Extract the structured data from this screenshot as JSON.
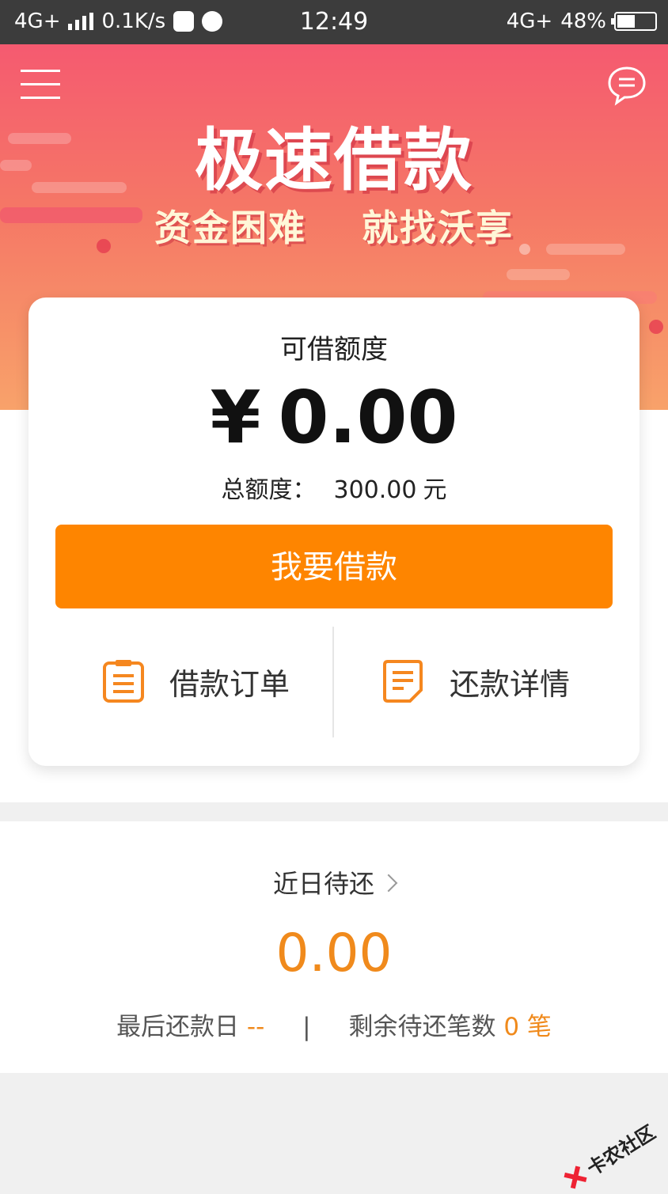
{
  "status_bar": {
    "network": "4G+",
    "speed": "0.1K/s",
    "time": "12:49",
    "network_right": "4G+",
    "battery": "48%",
    "battery_level": 0.48
  },
  "header": {
    "menu_icon": "hamburger-menu-icon",
    "chat_icon": "chat-bubble-icon"
  },
  "hero": {
    "title": "极速借款",
    "subtitle_left": "资金困难",
    "subtitle_right": "就找沃享"
  },
  "card": {
    "available_label": "可借额度",
    "currency": "¥",
    "available_amount": "0.00",
    "total_label": "总额度：",
    "total_amount": "300.00",
    "total_unit": "元",
    "borrow_button": "我要借款",
    "quick_links": [
      {
        "label": "借款订单",
        "icon": "clipboard-icon"
      },
      {
        "label": "还款详情",
        "icon": "document-list-icon"
      }
    ]
  },
  "recent_due": {
    "title": "近日待还",
    "amount": "0.00",
    "last_date_label": "最后还款日",
    "last_date_value": "--",
    "separator": "|",
    "remaining_label": "剩余待还笔数",
    "remaining_count": "0",
    "remaining_unit": "笔"
  },
  "watermark": "卡农社区",
  "colors": {
    "accent_orange": "#fe8500",
    "amount_orange": "#f08a1c",
    "hero_top": "#f55a70",
    "hero_bottom": "#f8a26a"
  }
}
